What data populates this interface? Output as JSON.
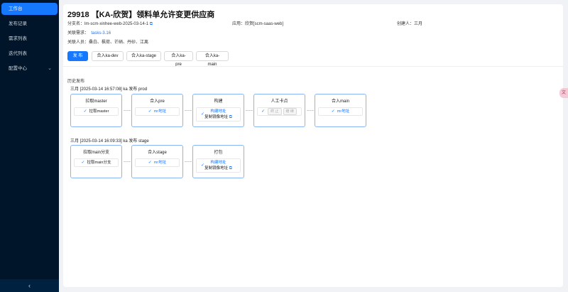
{
  "sidebar": {
    "items": [
      {
        "label": "工作台",
        "active": true
      },
      {
        "label": "发布记录"
      },
      {
        "label": "需求列表"
      },
      {
        "label": "迭代列表"
      },
      {
        "label": "配置中心",
        "expandable": true
      }
    ],
    "collapse_icon": "‹"
  },
  "header": {
    "title": "29918 【KA-欣贺】领料单允许变更供应商",
    "branch_label": "分支名：",
    "branch_value": "lm-scm-xinhee-web-2025-03-14-1",
    "app_label": "应用：",
    "app_value": "欣贺[scm-saas-web]",
    "creator_label": "创建人：",
    "creator_value": "三月",
    "req_label": "关联需求：",
    "req_value": "tasks-3.16",
    "people_label": "关联人员：",
    "people_value": "桑白、枫荷、芒硝、丹砂、江离"
  },
  "actions": {
    "publish": "发 布",
    "merge_dev": "合入ka-dev",
    "merge_stage": "合入ka-stage",
    "merge_pre": "合入ka-pre",
    "merge_main": "合入ka-main"
  },
  "history": {
    "label": "历史发布",
    "runs": [
      {
        "header": "三月  [2025-03-14 16:57:08]  ka 发布 prod",
        "stages": [
          {
            "title": "拉取master",
            "step": "拉取master"
          },
          {
            "title": "合入pre",
            "step": "mr地址"
          },
          {
            "title": "构建",
            "step_line1": "构建地址",
            "step_line2": "复制镜像地址"
          },
          {
            "title": "人工卡点",
            "btn1": "终 止",
            "btn2": "继 续"
          },
          {
            "title": "合入main",
            "step": "mr地址"
          }
        ]
      },
      {
        "header": "三月  [2025-03-14 16:09:33]  ka 发布 stage",
        "stages": [
          {
            "title": "拉取main分支",
            "step": "拉取main分支"
          },
          {
            "title": "合入stage",
            "step": "mr地址"
          },
          {
            "title": "打包",
            "step_line1": "构建地址",
            "step_line2": "复制镜像地址"
          }
        ]
      }
    ]
  },
  "colors": {
    "sidebar_bg": "#001529",
    "accent": "#1677ff",
    "stage_border": "#8ab4f8"
  },
  "float_tab_icon": "translate-icon"
}
